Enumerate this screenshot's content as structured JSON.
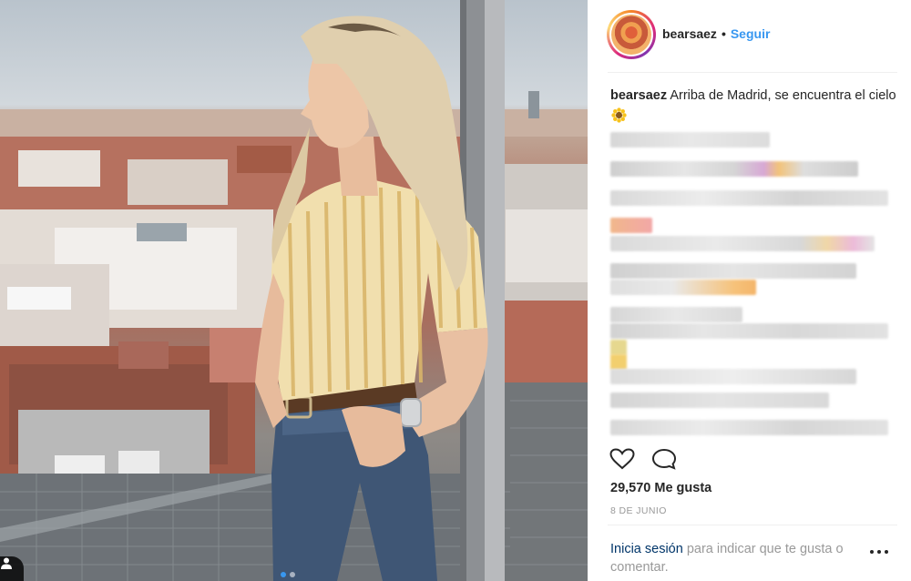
{
  "post": {
    "username": "bearsaez",
    "separator": "•",
    "follow_label": "Seguir",
    "caption_user": "bearsaez",
    "caption_text": "Arriba de Madrid, se encuentra el cielo",
    "caption_emoji": "sunflower-emoji",
    "likes": "29,570 Me gusta",
    "date": "8 DE JUNIO",
    "login_link": "Inicia sesión",
    "login_text": "para indicar que te gusta o comentar.",
    "carousel_current": 1,
    "carousel_total": 2
  },
  "icons": {
    "like": "heart-icon",
    "comment": "comment-icon",
    "more": "more-options-icon",
    "tag": "user-tag-icon"
  },
  "colors": {
    "accent": "#3897f0",
    "link_dark": "#003569",
    "muted": "#999999"
  }
}
